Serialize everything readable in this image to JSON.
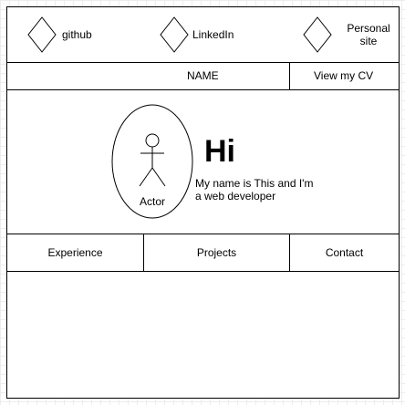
{
  "header": {
    "links": [
      {
        "label": "github",
        "icon": "diamond-icon"
      },
      {
        "label": "LinkedIn",
        "icon": "diamond-icon"
      },
      {
        "label_line1": "Personal",
        "label_line2": "site",
        "icon": "diamond-icon"
      }
    ]
  },
  "name_bar": {
    "name": "NAME",
    "cv_button": "View my CV"
  },
  "hero": {
    "avatar_label": "Actor",
    "greeting": "Hi",
    "intro_line1": "My name is This and I'm",
    "intro_line2": "a web developer"
  },
  "nav": {
    "experience": "Experience",
    "projects": "Projects",
    "contact": "Contact"
  }
}
